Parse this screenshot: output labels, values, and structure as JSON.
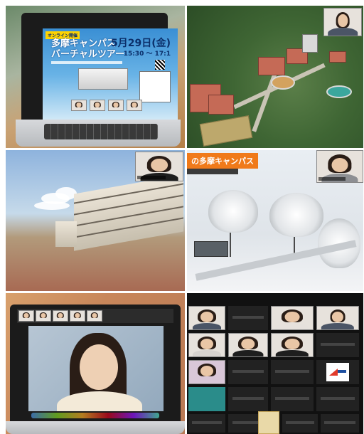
{
  "panels": {
    "laptop_poster": {
      "tag": "オンライン開催",
      "title_line1": "多摩キャンパス",
      "title_line2": "バーチャルツアー",
      "date": "5月29日(金)",
      "time": "15:30 〜 17:1"
    },
    "snow_view": {
      "banner": "の多摩キャンパス"
    }
  },
  "colors": {
    "banner_orange": "#f07a1a",
    "poster_blue": "#3a8fd4",
    "gallery_bg": "#111111",
    "tile_bg": "#222222"
  },
  "icons": [
    "qr-code-icon",
    "university-logo-icon"
  ]
}
